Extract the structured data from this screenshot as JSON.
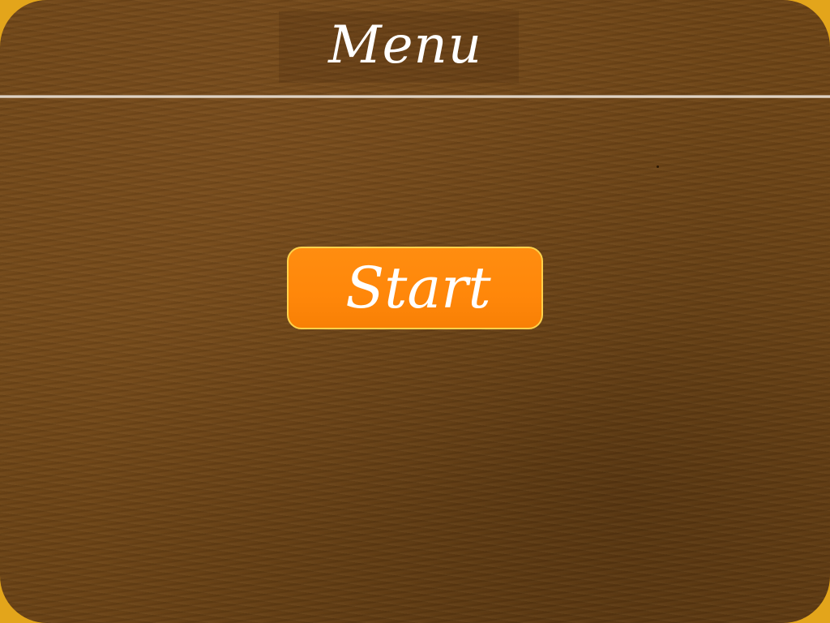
{
  "header": {
    "title": "Menu"
  },
  "menu": {
    "start_label": "Start"
  },
  "colors": {
    "frame": "#e3a51b",
    "panel": "#6e4516",
    "button_fill": "#ff8a0c",
    "button_border": "#ffd24a",
    "text": "#ffffff"
  }
}
